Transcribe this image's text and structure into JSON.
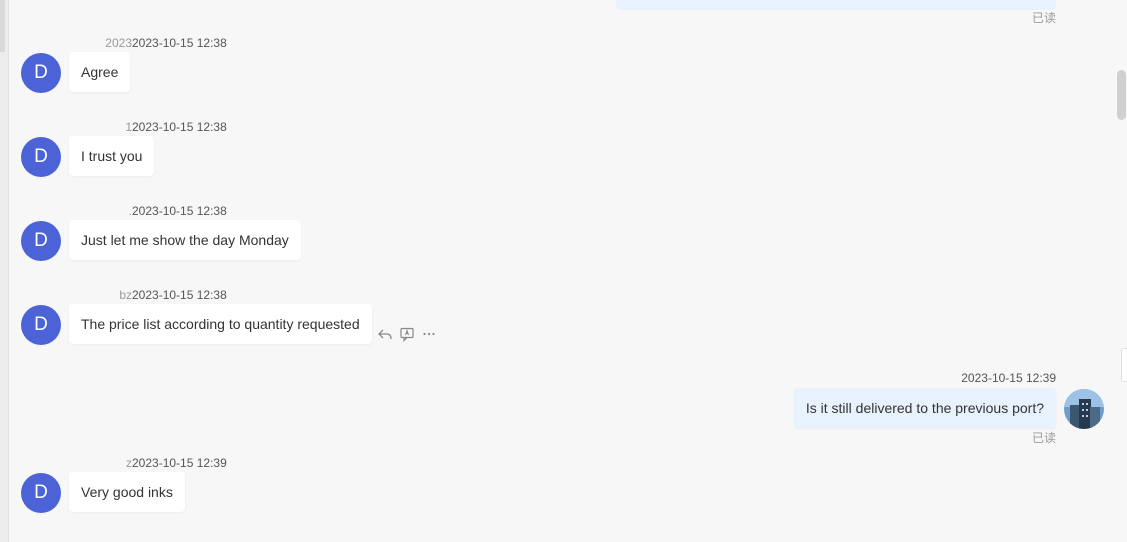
{
  "read_label": "已读",
  "messages": [
    {
      "sender": "2023",
      "time": "2023-10-15 12:38",
      "avatar": "D",
      "text": "Agree"
    },
    {
      "sender": "1",
      "time": "2023-10-15 12:38",
      "avatar": "D",
      "text": "I trust you"
    },
    {
      "sender": ".",
      "time": "2023-10-15 12:38",
      "avatar": "D",
      "text": "Just let me show the day Monday"
    },
    {
      "sender": "bz",
      "time": "2023-10-15 12:38",
      "avatar": "D",
      "text": "The price list according to quantity requested"
    },
    {
      "sender": "z",
      "time": "2023-10-15 12:39",
      "avatar": "D",
      "text": "Very good inks"
    }
  ],
  "my_message": {
    "time": "2023-10-15 12:39",
    "text": "Is it still delivered to the previous port?"
  },
  "message_actions": [
    "reply-icon",
    "translate-icon",
    "more-icon"
  ],
  "colors": {
    "avatar": "#4b63d6",
    "my_bubble": "#e8f2fd",
    "background": "#f7f7f7"
  }
}
